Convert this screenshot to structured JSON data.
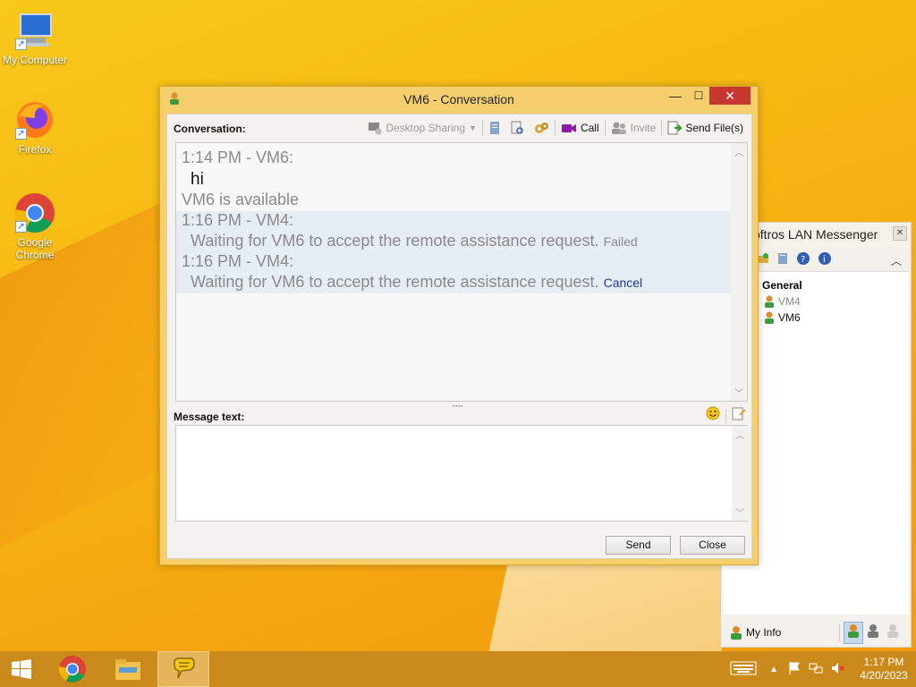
{
  "desktop": {
    "icons": [
      {
        "label": "My Computer"
      },
      {
        "label": "Firefox"
      },
      {
        "label": "Google Chrome"
      }
    ]
  },
  "conversation_window": {
    "title": "VM6 - Conversation",
    "conversation_label": "Conversation:",
    "toolbar": {
      "desktop_sharing": "Desktop Sharing",
      "call": "Call",
      "invite": "Invite",
      "send_files": "Send File(s)"
    },
    "history": [
      {
        "text": "1:14 PM - VM6:"
      },
      {
        "text": "hi"
      },
      {
        "text": "VM6 is available"
      },
      {
        "text": "1:16 PM - VM4:"
      },
      {
        "text": "Waiting for VM6 to accept the remote assistance request.",
        "status": "Failed"
      },
      {
        "text": "1:16 PM - VM4:"
      },
      {
        "text": "Waiting for VM6 to accept the remote assistance request.",
        "action": "Cancel"
      }
    ],
    "message_label": "Message text:",
    "message_value": "",
    "send_label": "Send",
    "close_label": "Close"
  },
  "messenger": {
    "title": "Softros LAN Messenger",
    "title_visible": "oftros LAN Messenger",
    "group": "General",
    "users": [
      "VM4",
      "VM6"
    ],
    "my_info": "My Info"
  },
  "taskbar": {
    "time": "1:17 PM",
    "date": "4/20/2023"
  }
}
